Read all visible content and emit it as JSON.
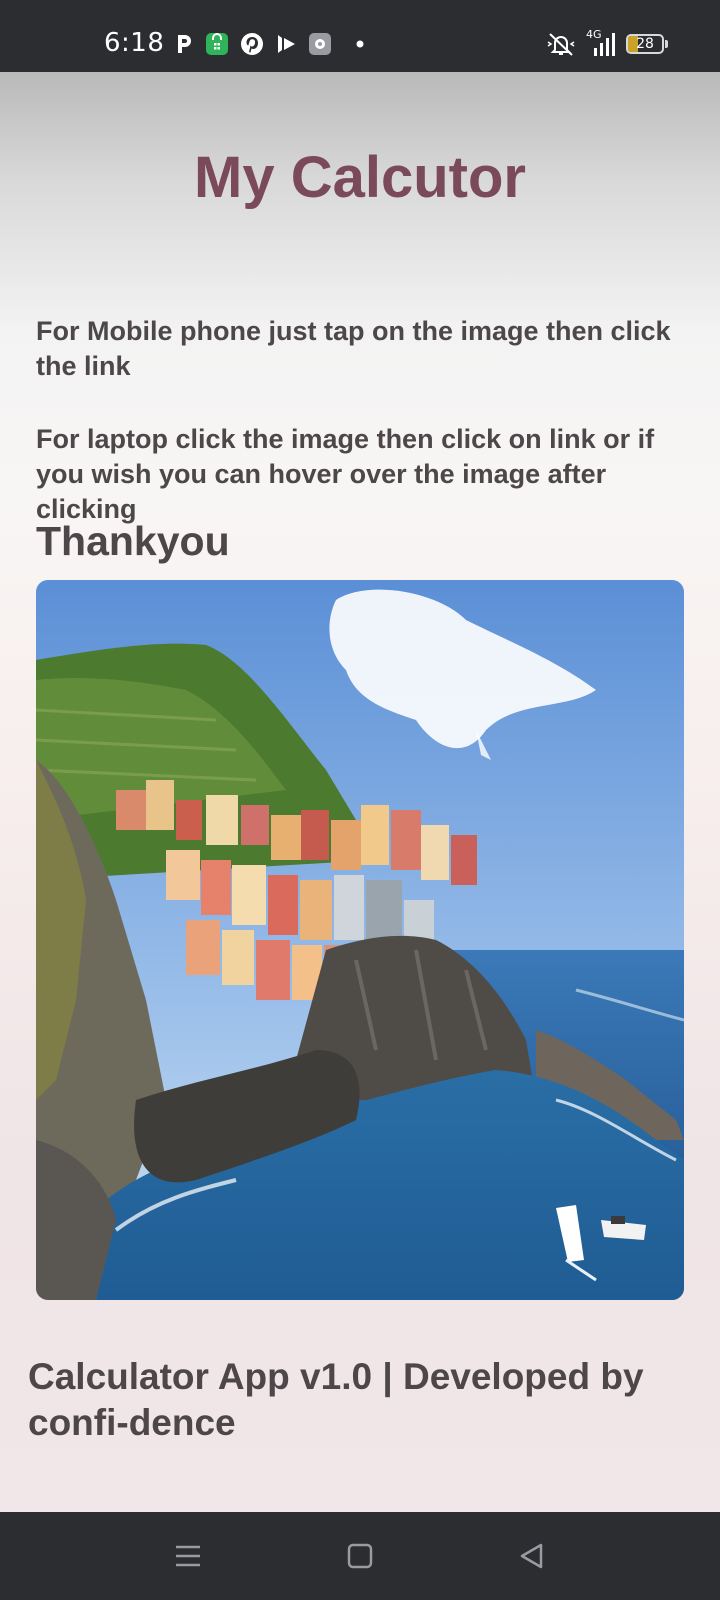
{
  "status_bar": {
    "time": "6:18",
    "network": "4G",
    "battery_level": "28",
    "battery_fraction": 0.28,
    "icons": [
      "p-app-icon",
      "shopping-bag-icon",
      "pinterest-icon",
      "play-app-icon",
      "settings-app-icon",
      "dot-icon",
      "mute-icon",
      "signal-icon",
      "battery-icon"
    ]
  },
  "main": {
    "title": "My Calcutor",
    "instruction_mobile": "For Mobile phone just tap on the image then click the link",
    "instruction_laptop": "For laptop click the image then click on link or if you wish you can hover over the image after clicking",
    "thanks": "Thankyou",
    "image_icon": "coastal-village-photo"
  },
  "footer": {
    "text": "Calculator App v1.0 | Developed by confi-dence"
  },
  "nav_bar": {
    "icons": [
      "menu-icon",
      "home-icon",
      "back-icon"
    ]
  },
  "colors": {
    "title": "#7a4a5a",
    "text": "#4d4749",
    "bars": "#2c2d31"
  }
}
